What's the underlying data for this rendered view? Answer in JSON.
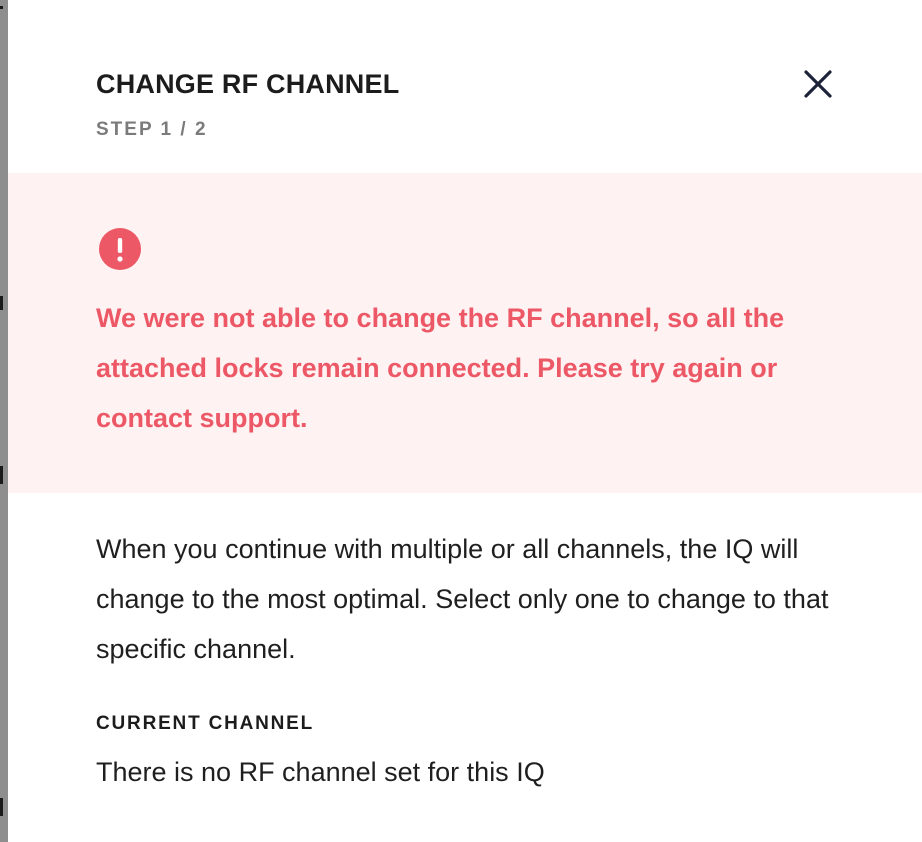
{
  "modal": {
    "title": "CHANGE RF CHANNEL",
    "step": "STEP 1 / 2",
    "close_icon": "close-icon"
  },
  "error": {
    "icon": "exclamation-circle-icon",
    "message": "We were not able to change the RF channel, so all the attached locks remain connected. Please try again or contact support.",
    "color": "#ec5866",
    "background": "#fff2f3"
  },
  "description": "When you continue with multiple or all channels, the IQ will change to the most optimal. Select only one to change to that specific channel.",
  "current_channel": {
    "label": "CURRENT CHANNEL",
    "value": "There is no RF channel set for this IQ"
  }
}
